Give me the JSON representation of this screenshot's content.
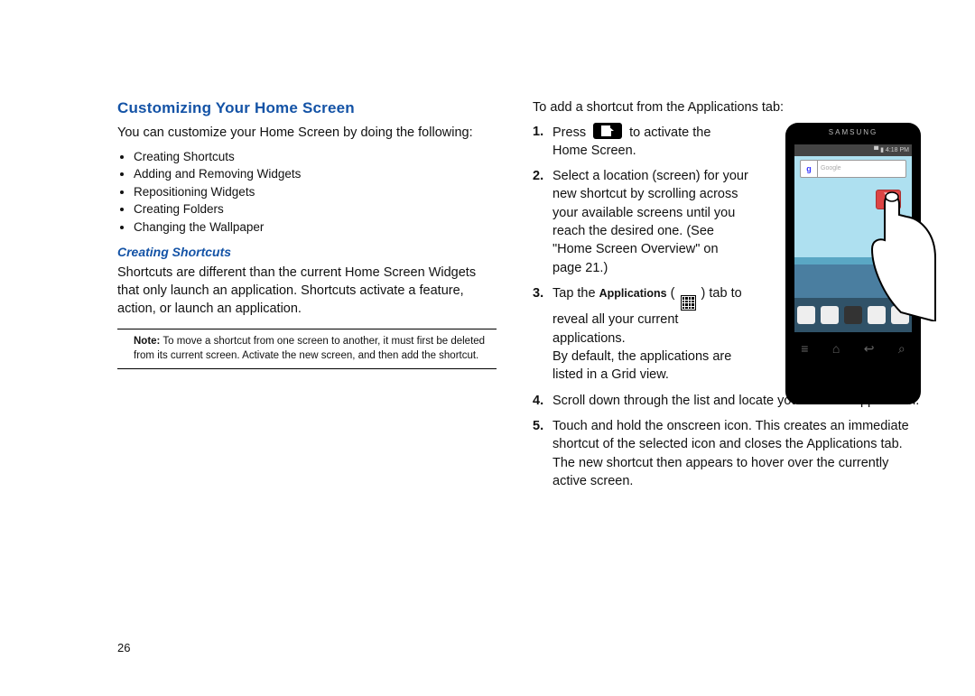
{
  "page_number": "26",
  "heading": "Customizing Your Home Screen",
  "intro": "You can customize your Home Screen by doing the following:",
  "bullets": [
    "Creating Shortcuts",
    "Adding and Removing Widgets",
    "Repositioning Widgets",
    "Creating Folders",
    "Changing the Wallpaper"
  ],
  "subheading": "Creating Shortcuts",
  "shortcuts_para": "Shortcuts are different than the current Home Screen Widgets that only launch an application. Shortcuts activate a feature, action, or launch an application.",
  "note_label": "Note:",
  "note_text": " To move a shortcut from one screen to another, it must first be deleted from its current screen. Activate the new screen, and then add the shortcut.",
  "right_intro": "To add a shortcut from the Applications tab:",
  "steps": {
    "s1_a": "Press ",
    "s1_b": " to activate the Home Screen.",
    "s2": "Select a location (screen) for your new shortcut by scrolling across your available screens until you reach the desired one. (See \"Home Screen Overview\" on page 21.)",
    "s3_a": "Tap the ",
    "s3_apps_label": "Applications",
    "s3_b": " tab to reveal all your current applications.",
    "s3_c": "By default, the applications are listed in a Grid view.",
    "s4": "Scroll down through the list and locate your desired application.",
    "s5": "Touch and hold the onscreen icon. This creates an immediate shortcut of the selected icon and closes the Applications tab. The new shortcut then appears to hover over the currently active screen."
  },
  "phone": {
    "brand": "SAMSUNG",
    "status_time": "4:18 PM",
    "search_logo": "g",
    "search_placeholder": "Google"
  }
}
